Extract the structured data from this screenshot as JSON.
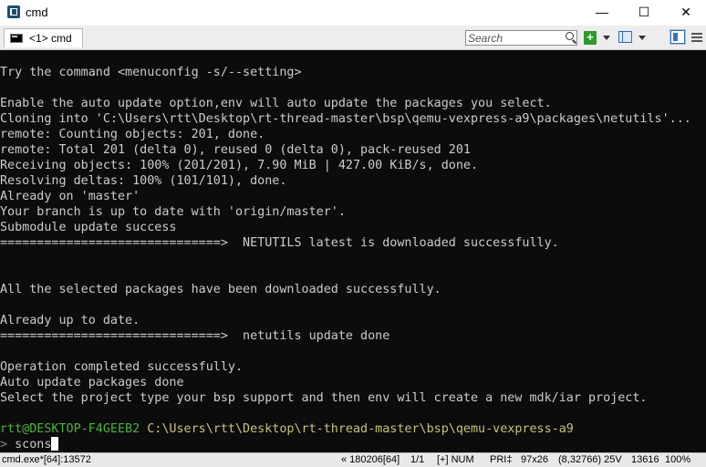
{
  "window": {
    "title": "cmd",
    "minimize_glyph": "—",
    "maximize_glyph": "☐",
    "close_glyph": "✕"
  },
  "toolbar": {
    "tab_label": "<1> cmd",
    "search_placeholder": "Search",
    "new_console_glyph": "+"
  },
  "console": {
    "lines": [
      "Try the command <menuconfig -s/--setting>",
      "",
      "Enable the auto update option,env will auto update the packages you select.",
      "Cloning into 'C:\\Users\\rtt\\Desktop\\rt-thread-master\\bsp\\qemu-vexpress-a9\\packages\\netutils'...",
      "remote: Counting objects: 201, done.",
      "remote: Total 201 (delta 0), reused 0 (delta 0), pack-reused 201",
      "Receiving objects: 100% (201/201), 7.90 MiB | 427.00 KiB/s, done.",
      "Resolving deltas: 100% (101/101), done.",
      "Already on 'master'",
      "Your branch is up to date with 'origin/master'.",
      "Submodule update success",
      "==============================>  NETUTILS latest is downloaded successfully.",
      "",
      "",
      "All the selected packages have been downloaded successfully.",
      "",
      "Already up to date.",
      "==============================>  netutils update done",
      "",
      "Operation completed successfully.",
      "Auto update packages done",
      "Select the project type your bsp support and then env will create a new mdk/iar project.",
      ""
    ],
    "prompt_user": "rtt@DESKTOP-F4GEEB2",
    "prompt_path": "C:\\Users\\rtt\\Desktop\\rt-thread-master\\bsp\\qemu-vexpress-a9",
    "prompt_symbol": ">",
    "command": "scons"
  },
  "statusbar": {
    "process": "cmd.exe*[64]:13572",
    "build": "« 180206[64]",
    "page": "1/1",
    "mode": "[+] NUM",
    "priority": "PRI‡",
    "size": "97x26",
    "cursor_pos": "(8,32766) 25V",
    "pid": "13616",
    "zoom": "100%"
  },
  "colors": {
    "console_bg": "#0c0c0c",
    "console_fg": "#cccccc",
    "prompt_user": "#4fb33c",
    "prompt_path": "#c8c27a"
  }
}
